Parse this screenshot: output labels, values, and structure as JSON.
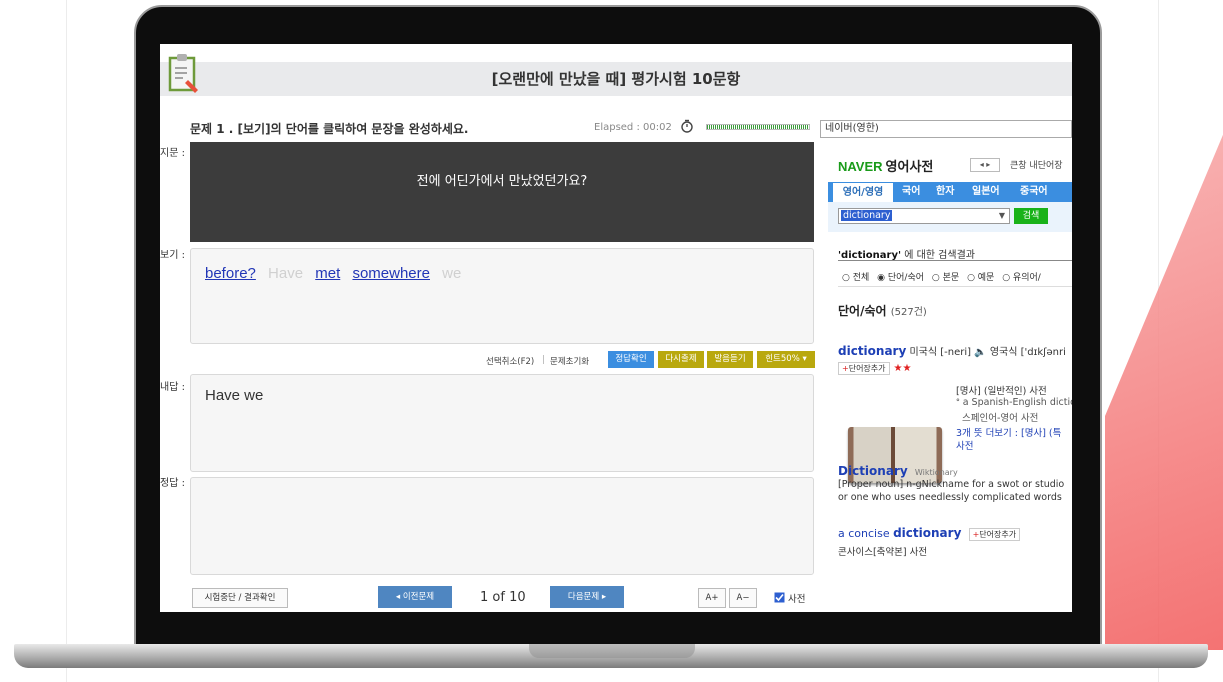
{
  "header": {
    "title": "[오랜만에 만났을 때] 평가시험 10문항"
  },
  "question": {
    "instruction": "문제 1 . [보기]의 단어를 클릭하여 문장을 완성하세요.",
    "elapsed": "Elapsed : 00:02",
    "prompt_text": "전에 어딘가에서 만났었던가요?"
  },
  "labels": {
    "prompt": "지문 :",
    "choices": "보기 :",
    "my_answer": "내답 :",
    "correct": "정답 :"
  },
  "choices": [
    {
      "text": "before?",
      "state": "available"
    },
    {
      "text": "Have",
      "state": "used"
    },
    {
      "text": "met",
      "state": "available"
    },
    {
      "text": "somewhere",
      "state": "available"
    },
    {
      "text": "we",
      "state": "used"
    }
  ],
  "controls": {
    "deselect": "선택취소(F2)",
    "separator": "|",
    "reset": "문제초기화",
    "check": "정답확인",
    "retry": "다시출제",
    "listen": "발음듣기",
    "hint": "힌트50% ▾"
  },
  "my_answer": "Have we",
  "correct_answer": "",
  "bottom": {
    "stop": "시험중단 / 결과확인",
    "prev": "◂ 이전문제",
    "page": "1 of 10",
    "next": "다음문제 ▸",
    "font_up": "A+",
    "font_down": "A−",
    "dict_label": "사전",
    "dict_checked": true
  },
  "dictionary": {
    "source_select": "네이버(영한)",
    "brand": "NAVER",
    "brand_sub": "영어사전",
    "arrows": "◂ ▸",
    "links": "큰창  내단어장",
    "tabs": [
      "영어/영영",
      "국어",
      "한자",
      "일본어",
      "중국어"
    ],
    "query": "dictionary",
    "search_button": "검색",
    "result_title_term": "'dictionary'",
    "result_title_suffix": " 에 대한 검색결과",
    "filters": [
      "○ 전체",
      "◉ 단어/숙어",
      "○ 본문",
      "○ 예문",
      "○ 유의어/"
    ],
    "section_title": "단어/숙어",
    "section_count": "(527건)",
    "entry1": {
      "headword": "dictionary",
      "pron": " 미국식 [-neri] 🔈 영국식 ['dɪkʃənri",
      "add_tag": "단어장추가",
      "stars": "★★",
      "def1": "[명사] (일반적인) 사전",
      "def2": "ᐤ a Spanish-English diction",
      "def3": "스페인어-영어 사전",
      "more1": "3개 뜻 더보기 : [명사] (특",
      "more2": "사전"
    },
    "entry2": {
      "headword": "Dictionary",
      "source": "Wiktionary",
      "line1": "[Proper noun] n-gNickname for a swot or studio",
      "line2": "or one who uses needlessly complicated words"
    },
    "entry3": {
      "prefix": "a concise ",
      "headword": "dictionary",
      "add_tag": "단어장추가",
      "meaning": "콘사이스[축약본] 사전"
    }
  },
  "colors": {
    "accent_blue": "#3b8ee0",
    "olive": "#b9a80e",
    "naver_green": "#1a9b1a",
    "link_blue": "#1d3fb5"
  }
}
